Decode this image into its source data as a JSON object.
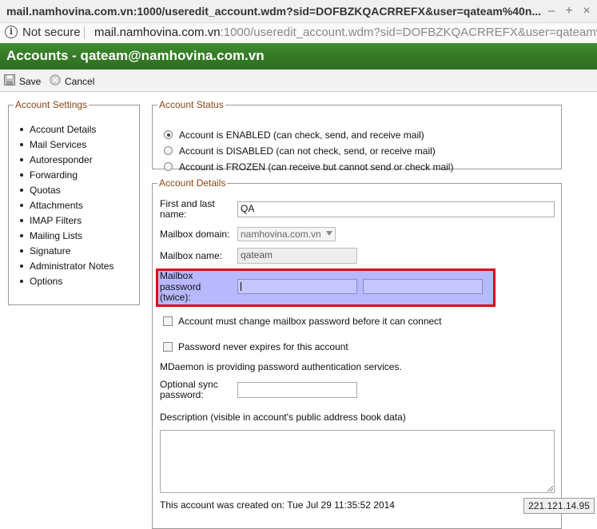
{
  "window": {
    "title": "mail.namhovina.com.vn:1000/useredit_account.wdm?sid=DOFBZKQACRREFX&user=qateam%40n...",
    "minimize_glyph": "–",
    "maximize_glyph": "+",
    "close_glyph": "×"
  },
  "address_bar": {
    "security_label": "Not secure",
    "host": "mail.namhovina.com.vn",
    "path": ":1000/useredit_account.wdm?sid=DOFBZKQACRREFX&user=qateam%4"
  },
  "header": {
    "title": "Accounts - qateam@namhovina.com.vn"
  },
  "toolbar": {
    "save_label": "Save",
    "cancel_label": "Cancel"
  },
  "settings_nav": {
    "legend": "Account Settings",
    "items": [
      {
        "label": "Account Details"
      },
      {
        "label": "Mail Services"
      },
      {
        "label": "Autoresponder"
      },
      {
        "label": "Forwarding"
      },
      {
        "label": "Quotas"
      },
      {
        "label": "Attachments"
      },
      {
        "label": "IMAP Filters"
      },
      {
        "label": "Mailing Lists"
      },
      {
        "label": "Signature"
      },
      {
        "label": "Administrator Notes"
      },
      {
        "label": "Options"
      }
    ]
  },
  "account_status": {
    "legend": "Account Status",
    "options": [
      {
        "label": "Account is ENABLED (can check, send, and receive mail)",
        "selected": true
      },
      {
        "label": "Account is DISABLED (can not check, send, or receive mail)",
        "selected": false
      },
      {
        "label": "Account is FROZEN (can receive but cannot send or check mail)",
        "selected": false
      }
    ]
  },
  "account_details": {
    "legend": "Account Details",
    "full_name_label_line1": "First and last",
    "full_name_label_line2": "name:",
    "full_name_value": "QA",
    "domain_label": "Mailbox domain:",
    "domain_value": "namhovina.com.vn",
    "mailbox_name_label": "Mailbox name:",
    "mailbox_name_value": "qateam",
    "password_label_line1": "Mailbox",
    "password_label_line2": "password",
    "password_label_line3": "(twice):",
    "password_value": "",
    "password_confirm_value": "",
    "must_change_label": "Account must change mailbox password before it can connect",
    "must_change_checked": false,
    "never_expires_label": "Password never expires for this account",
    "never_expires_checked": false,
    "auth_info": "MDaemon is providing password authentication services.",
    "sync_password_label_line1": "Optional sync",
    "sync_password_label_line2": "password:",
    "sync_password_value": "",
    "description_label": "Description (visible in account's public address book data)",
    "description_value": "",
    "created_text": "This account was created on: Tue Jul 29 11:35:52 2014"
  },
  "status_tooltip": {
    "text": "221.121.14.95"
  },
  "colors": {
    "header_green": "#2d6c1e",
    "legend_brown": "#8b4513",
    "highlight_border": "#e0001b",
    "highlight_fill": "#b8b8ff"
  }
}
